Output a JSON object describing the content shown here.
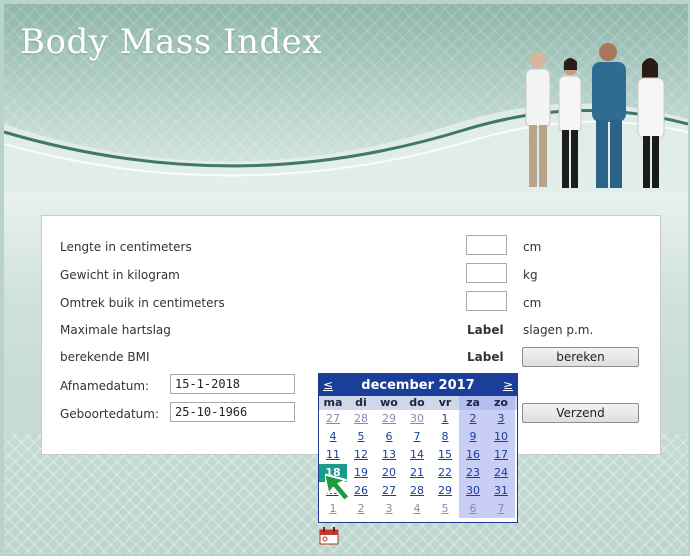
{
  "header": {
    "title": "Body Mass Index"
  },
  "form": {
    "length_label": "Lengte in centimeters",
    "length_unit": "cm",
    "weight_label": "Gewicht in kilogram",
    "weight_unit": "kg",
    "waist_label": "Omtrek buik in centimeters",
    "waist_unit": "cm",
    "max_hr_label": "Maximale hartslag",
    "max_hr_value": "Label",
    "max_hr_unit": "slagen p.m.",
    "bmi_label": "berekende BMI",
    "bmi_value": "Label",
    "calculate_button": "bereken",
    "intake_date_label": "Afnamedatum:",
    "intake_date_value": "15-1-2018",
    "birth_date_label": "Geboortedatum:",
    "birth_date_value": "25-10-1966",
    "send_button": "Verzend"
  },
  "calendar": {
    "prev": "≤",
    "next": "≥",
    "month": "december 2017",
    "weekdays": [
      "ma",
      "di",
      "wo",
      "do",
      "vr",
      "za",
      "zo"
    ],
    "weeks": [
      [
        "27",
        "28",
        "29",
        "30",
        "1",
        "2",
        "3"
      ],
      [
        "4",
        "5",
        "6",
        "7",
        "8",
        "9",
        "10"
      ],
      [
        "11",
        "12",
        "13",
        "14",
        "15",
        "16",
        "17"
      ],
      [
        "18",
        "19",
        "20",
        "21",
        "22",
        "23",
        "24"
      ],
      [
        "25",
        "26",
        "27",
        "28",
        "29",
        "30",
        "31"
      ],
      [
        "1",
        "2",
        "3",
        "4",
        "5",
        "6",
        "7"
      ]
    ],
    "selected_day": "18"
  },
  "colors": {
    "calendar_header": "#1b3e98",
    "calendar_today": "#1a9b8c",
    "calendar_weekend": "#c8cef5",
    "cursor": "#1f9a3c"
  },
  "icons": {
    "calendar": "calendar-icon",
    "cursor": "cursor-arrow-icon"
  }
}
